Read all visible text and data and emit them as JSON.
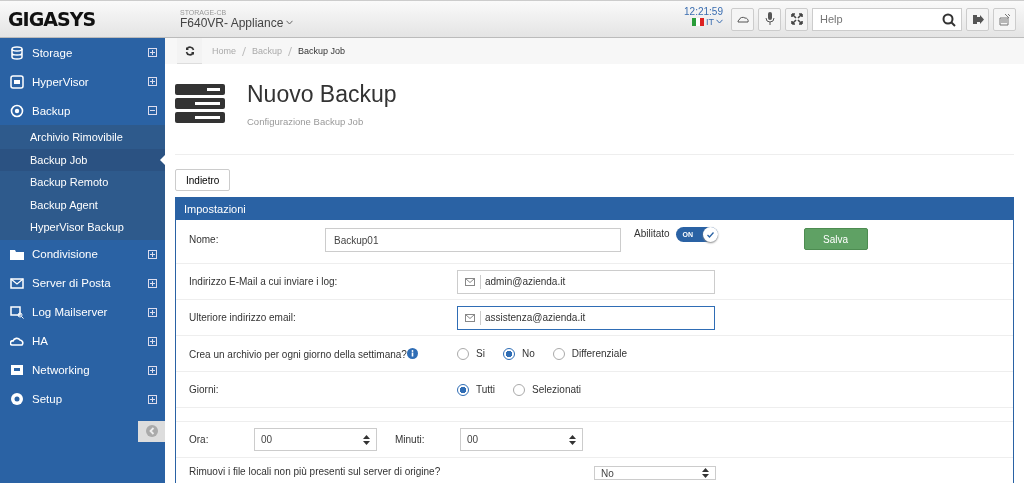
{
  "topbar": {
    "logo": "GIGASYS",
    "device_caption": "STORAGE-CB",
    "device_name": "F640VR- Appliance",
    "clock": "12:21:59",
    "language": "IT",
    "search": {
      "placeholder": "Help"
    }
  },
  "sidebar": {
    "items": [
      {
        "label": "Storage",
        "expanded": false
      },
      {
        "label": "HyperVisor",
        "expanded": false
      },
      {
        "label": "Backup",
        "expanded": true,
        "children": [
          {
            "label": "Archivio Rimovibile",
            "selected": false
          },
          {
            "label": "Backup Job",
            "selected": true
          },
          {
            "label": "Backup Remoto",
            "selected": false
          },
          {
            "label": "Backup Agent",
            "selected": false
          },
          {
            "label": "HyperVisor Backup",
            "selected": false
          }
        ]
      },
      {
        "label": "Condivisione",
        "expanded": false
      },
      {
        "label": "Server di Posta",
        "expanded": false
      },
      {
        "label": "Log Mailserver",
        "expanded": false
      },
      {
        "label": "HA",
        "expanded": false
      },
      {
        "label": "Networking",
        "expanded": false
      },
      {
        "label": "Setup",
        "expanded": false
      }
    ]
  },
  "breadcrumb": [
    "Home",
    "Backup",
    "Backup Job"
  ],
  "page": {
    "title": "Nuovo Backup",
    "subtitle": "Configurazione Backup Job",
    "back_button": "Indietro"
  },
  "panel": {
    "title": "Impostazioni",
    "name_row": {
      "label": "Nome:",
      "value": "Backup01",
      "enabled_label": "Abilitato",
      "toggle": {
        "label": "ON",
        "on": true
      },
      "save_button": "Salva"
    },
    "rows": [
      {
        "kind": "email",
        "label": "Indirizzo E-Mail a cui inviare i log:",
        "value": "admin@azienda.it",
        "focused": false
      },
      {
        "kind": "email",
        "label": "Ulteriore indirizzo email:",
        "value": "assistenza@azienda.it",
        "focused": true
      },
      {
        "kind": "radio",
        "label": "Crea un archivio per ogni giorno della settimana?",
        "info": true,
        "options": [
          {
            "label": "Si",
            "selected": false
          },
          {
            "label": "No",
            "selected": true
          },
          {
            "label": "Differenziale",
            "selected": false
          }
        ]
      },
      {
        "kind": "radio",
        "label": "Giorni:",
        "info": false,
        "options": [
          {
            "label": "Tutti",
            "selected": true
          },
          {
            "label": "Selezionati",
            "selected": false
          }
        ]
      },
      {
        "kind": "blank"
      },
      {
        "kind": "time",
        "label": "Ora:",
        "value": "00",
        "label2": "Minuti:",
        "value2": "00"
      },
      {
        "kind": "select",
        "label": "Rimuovi i file locali non più presenti sul server di origine?",
        "value": "No"
      }
    ]
  }
}
